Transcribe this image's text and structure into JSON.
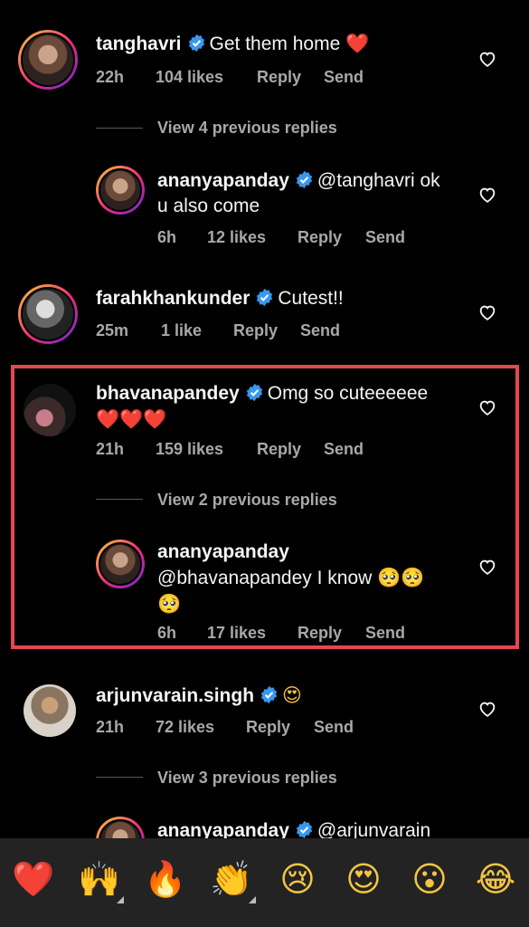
{
  "comments": [
    {
      "username": "tanghavri",
      "text": "Get them home",
      "emoji": "❤️",
      "time": "22h",
      "likes": "104 likes",
      "reply": "Reply",
      "send": "Send"
    },
    {
      "view_replies": "View 4 previous replies"
    },
    {
      "username": "ananyapanday",
      "text": "@tanghavri ok",
      "text2": "u also come",
      "time": "6h",
      "likes": "12 likes",
      "reply": "Reply",
      "send": "Send"
    },
    {
      "username": "farahkhankunder",
      "text": "Cutest!!",
      "time": "25m",
      "likes": "1 like",
      "reply": "Reply",
      "send": "Send"
    },
    {
      "username": "bhavanapandey",
      "text": "Omg so cuteeeeee",
      "emoji": "❤️❤️❤️",
      "time": "21h",
      "likes": "159 likes",
      "reply": "Reply",
      "send": "Send"
    },
    {
      "view_replies": "View 2 previous replies"
    },
    {
      "username": "ananyapanday",
      "text": "@bhavanapandey I know",
      "emoji": "🥺🥺",
      "emoji2": "🥺",
      "time": "6h",
      "likes": "17 likes",
      "reply": "Reply",
      "send": "Send"
    },
    {
      "username": "arjunvarain.singh",
      "emoji": "😍",
      "time": "21h",
      "likes": "72 likes",
      "reply": "Reply",
      "send": "Send"
    },
    {
      "view_replies": "View 3 previous replies"
    },
    {
      "username": "ananyapanday",
      "text": "@arjunvarain"
    }
  ],
  "reactions": [
    "❤️",
    "🙌",
    "🔥",
    "👏",
    "😢",
    "😍",
    "😮",
    "😂"
  ],
  "colors": {
    "verified": "#3897f0",
    "highlight": "#e64653",
    "meta": "#a8a8a8",
    "reaction_bar": "#232323"
  }
}
